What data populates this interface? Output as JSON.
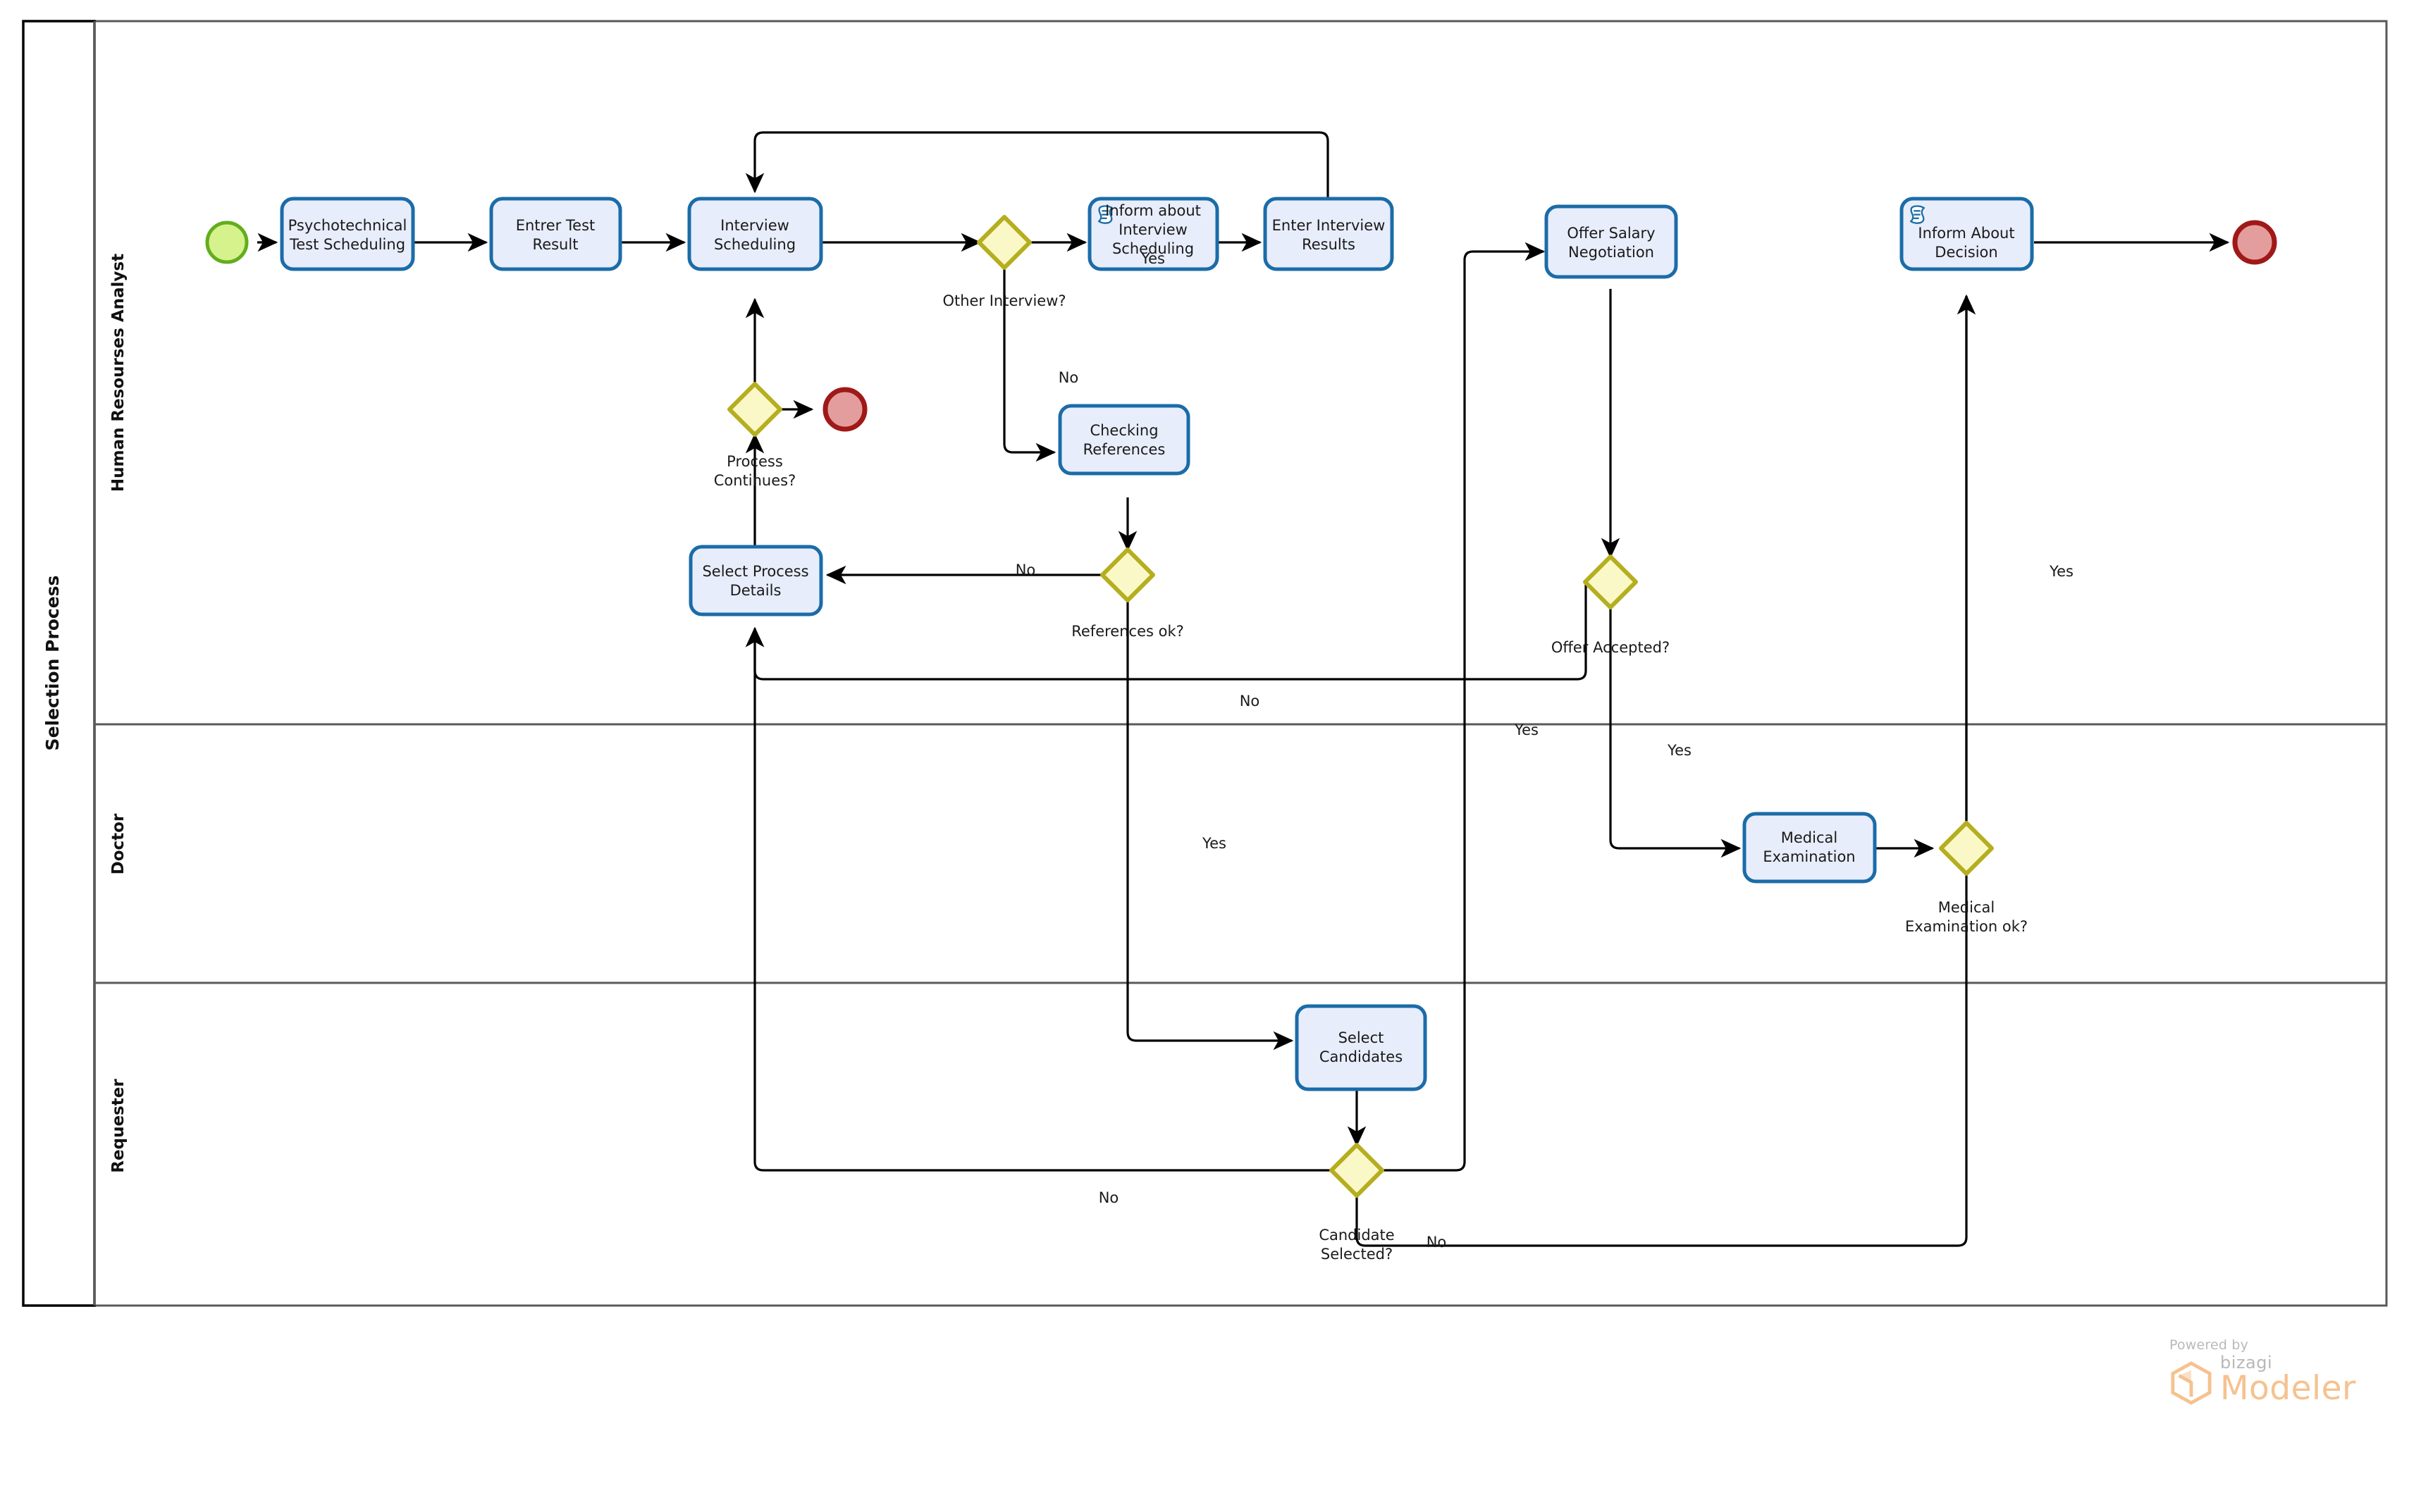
{
  "pool": {
    "title": "Selection Process",
    "lanes": [
      {
        "id": "hr",
        "label": "Human Resourses Analyst"
      },
      {
        "id": "doctor",
        "label": "Doctor"
      },
      {
        "id": "requester",
        "label": "Requester"
      }
    ]
  },
  "colors": {
    "task_fill": "#e8edfb",
    "task_stroke": "#1b6ca8",
    "gateway_fill": "#fbf8c8",
    "gateway_stroke": "#b5ae1f",
    "start_fill": "#d6f28c",
    "start_stroke": "#63ad1e",
    "end_fill": "#e49d9d",
    "end_stroke": "#a01818",
    "flow_stroke": "#000000",
    "pool_stroke": "#000000",
    "lane_stroke": "#595959",
    "text": "#1a1a1a",
    "logo_accent": "#f5c28f"
  },
  "nodes": {
    "start_event": {
      "type": "start-event",
      "label": ""
    },
    "task_psychotechnical": {
      "type": "task",
      "label": "Psychotechnical Test Scheduling",
      "lines": [
        "Psychotechnical",
        "Test Scheduling"
      ]
    },
    "task_enter_test_result": {
      "type": "task",
      "label": "Entrer Test Result",
      "lines": [
        "Entrer Test",
        "Result"
      ]
    },
    "task_interview_scheduling": {
      "type": "task",
      "label": "Interview Scheduling",
      "lines": [
        "Interview",
        "Scheduling"
      ]
    },
    "gateway_other_interview": {
      "type": "gateway",
      "label": "Other Interview?"
    },
    "task_inform_interview": {
      "type": "task-script",
      "label": "Inform about Interview Scheduling",
      "lines": [
        "Inform about",
        "Interview",
        "Scheduling"
      ],
      "icon": "script-task-icon"
    },
    "task_enter_interview_results": {
      "type": "task",
      "label": "Enter Interview Results",
      "lines": [
        "Enter Interview",
        "Results"
      ]
    },
    "gateway_process_continues": {
      "type": "gateway",
      "label": "Process Continues?",
      "lines": [
        "Process",
        "Continues?"
      ]
    },
    "end_event_process_stops": {
      "type": "end-event",
      "label": ""
    },
    "task_checking_references": {
      "type": "task",
      "label": "Checking References",
      "lines": [
        "Checking",
        "References"
      ]
    },
    "gateway_references_ok": {
      "type": "gateway",
      "label": "References ok?"
    },
    "task_select_process_details": {
      "type": "task",
      "label": "Select Process Details",
      "lines": [
        "Select Process",
        "Details"
      ]
    },
    "task_offer_salary": {
      "type": "task",
      "label": "Offer Salary Negotiation",
      "lines": [
        "Offer Salary",
        "Negotiation"
      ]
    },
    "gateway_offer_accepted": {
      "type": "gateway",
      "label": "Offer Accepted?"
    },
    "task_inform_decision": {
      "type": "task-script",
      "label": "Inform About Decision",
      "lines": [
        "Inform About",
        "Decision"
      ],
      "icon": "script-task-icon"
    },
    "end_event_final": {
      "type": "end-event",
      "label": ""
    },
    "task_medical_exam": {
      "type": "task",
      "label": "Medical Examination",
      "lines": [
        "Medical",
        "Examination"
      ]
    },
    "gateway_medical_ok": {
      "type": "gateway",
      "label": "Medical Examination ok?",
      "lines": [
        "Medical",
        "Examination ok?"
      ]
    },
    "task_select_candidates": {
      "type": "task",
      "label": "Select Candidates",
      "lines": [
        "Select",
        "Candidates"
      ]
    },
    "gateway_candidate_selected": {
      "type": "gateway",
      "label": "Candidate Selected?",
      "lines": [
        "Candidate",
        "Selected?"
      ]
    }
  },
  "flow_labels": {
    "other_interview_yes": "Yes",
    "other_interview_no": "No",
    "references_no": "No",
    "references_yes": "Yes",
    "offer_accepted_yes_left": "Yes",
    "offer_accepted_yes_down": "Yes",
    "offer_accepted_no": "No",
    "medical_ok_yes": "Yes",
    "candidate_selected_no_left": "No",
    "candidate_selected_no_right": "No"
  },
  "branding": {
    "powered_by": "Powered by",
    "brand": "bizagi",
    "product": "Modeler"
  }
}
